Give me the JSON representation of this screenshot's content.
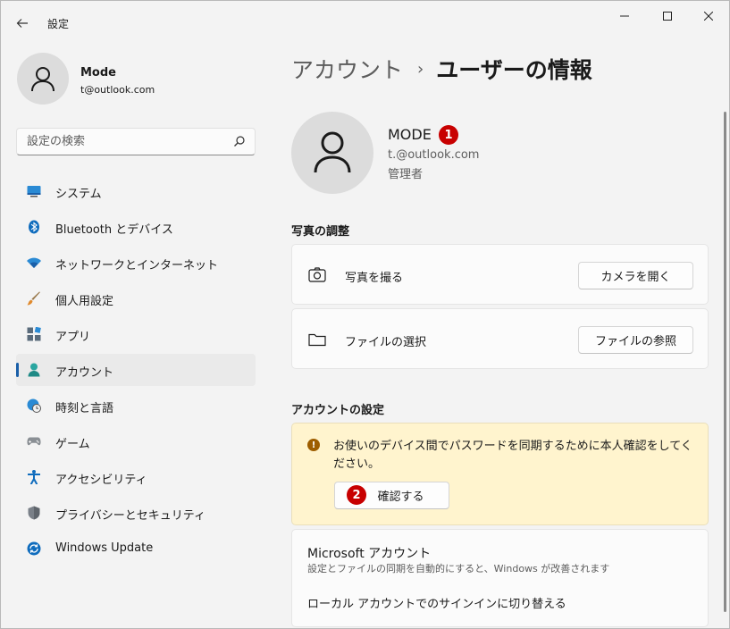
{
  "window": {
    "title": "設定"
  },
  "profile": {
    "name": "Mode",
    "email": "t@outlook.com"
  },
  "search": {
    "placeholder": "設定の検索"
  },
  "nav": {
    "items": [
      {
        "label": "システム",
        "icon": "monitor-icon"
      },
      {
        "label": "Bluetooth とデバイス",
        "icon": "bluetooth-icon"
      },
      {
        "label": "ネットワークとインターネット",
        "icon": "wifi-icon"
      },
      {
        "label": "個人用設定",
        "icon": "brush-icon"
      },
      {
        "label": "アプリ",
        "icon": "apps-icon"
      },
      {
        "label": "アカウント",
        "icon": "account-icon",
        "active": true
      },
      {
        "label": "時刻と言語",
        "icon": "globe-clock-icon"
      },
      {
        "label": "ゲーム",
        "icon": "gamepad-icon"
      },
      {
        "label": "アクセシビリティ",
        "icon": "accessibility-icon"
      },
      {
        "label": "プライバシーとセキュリティ",
        "icon": "shield-icon"
      },
      {
        "label": "Windows Update",
        "icon": "update-icon"
      }
    ]
  },
  "breadcrumb": {
    "parent": "アカウント",
    "separator": "›",
    "current": "ユーザーの情報"
  },
  "user": {
    "name": "MODE",
    "email": "t.@outlook.com",
    "role": "管理者"
  },
  "badges": {
    "one": "1",
    "two": "2"
  },
  "photo_section": {
    "title": "写真の調整",
    "take_photo_label": "写真を撮る",
    "camera_button": "カメラを開く",
    "choose_file_label": "ファイルの選択",
    "browse_button": "ファイルの参照"
  },
  "account_section": {
    "title": "アカウントの設定",
    "warning_text": "お使いのデバイス間でパスワードを同期するために本人確認をしてください。",
    "verify_button": "確認する"
  },
  "microsoft_account": {
    "title": "Microsoft アカウント",
    "description": "設定とファイルの同期を自動的にすると、Windows が改善されます",
    "switch_link": "ローカル アカウントでのサインインに切り替える"
  },
  "colors": {
    "accent": "#1a5fa8",
    "badge": "#c80000",
    "warning_bg": "#fff4ce",
    "warning_icon": "#9d5d00"
  }
}
